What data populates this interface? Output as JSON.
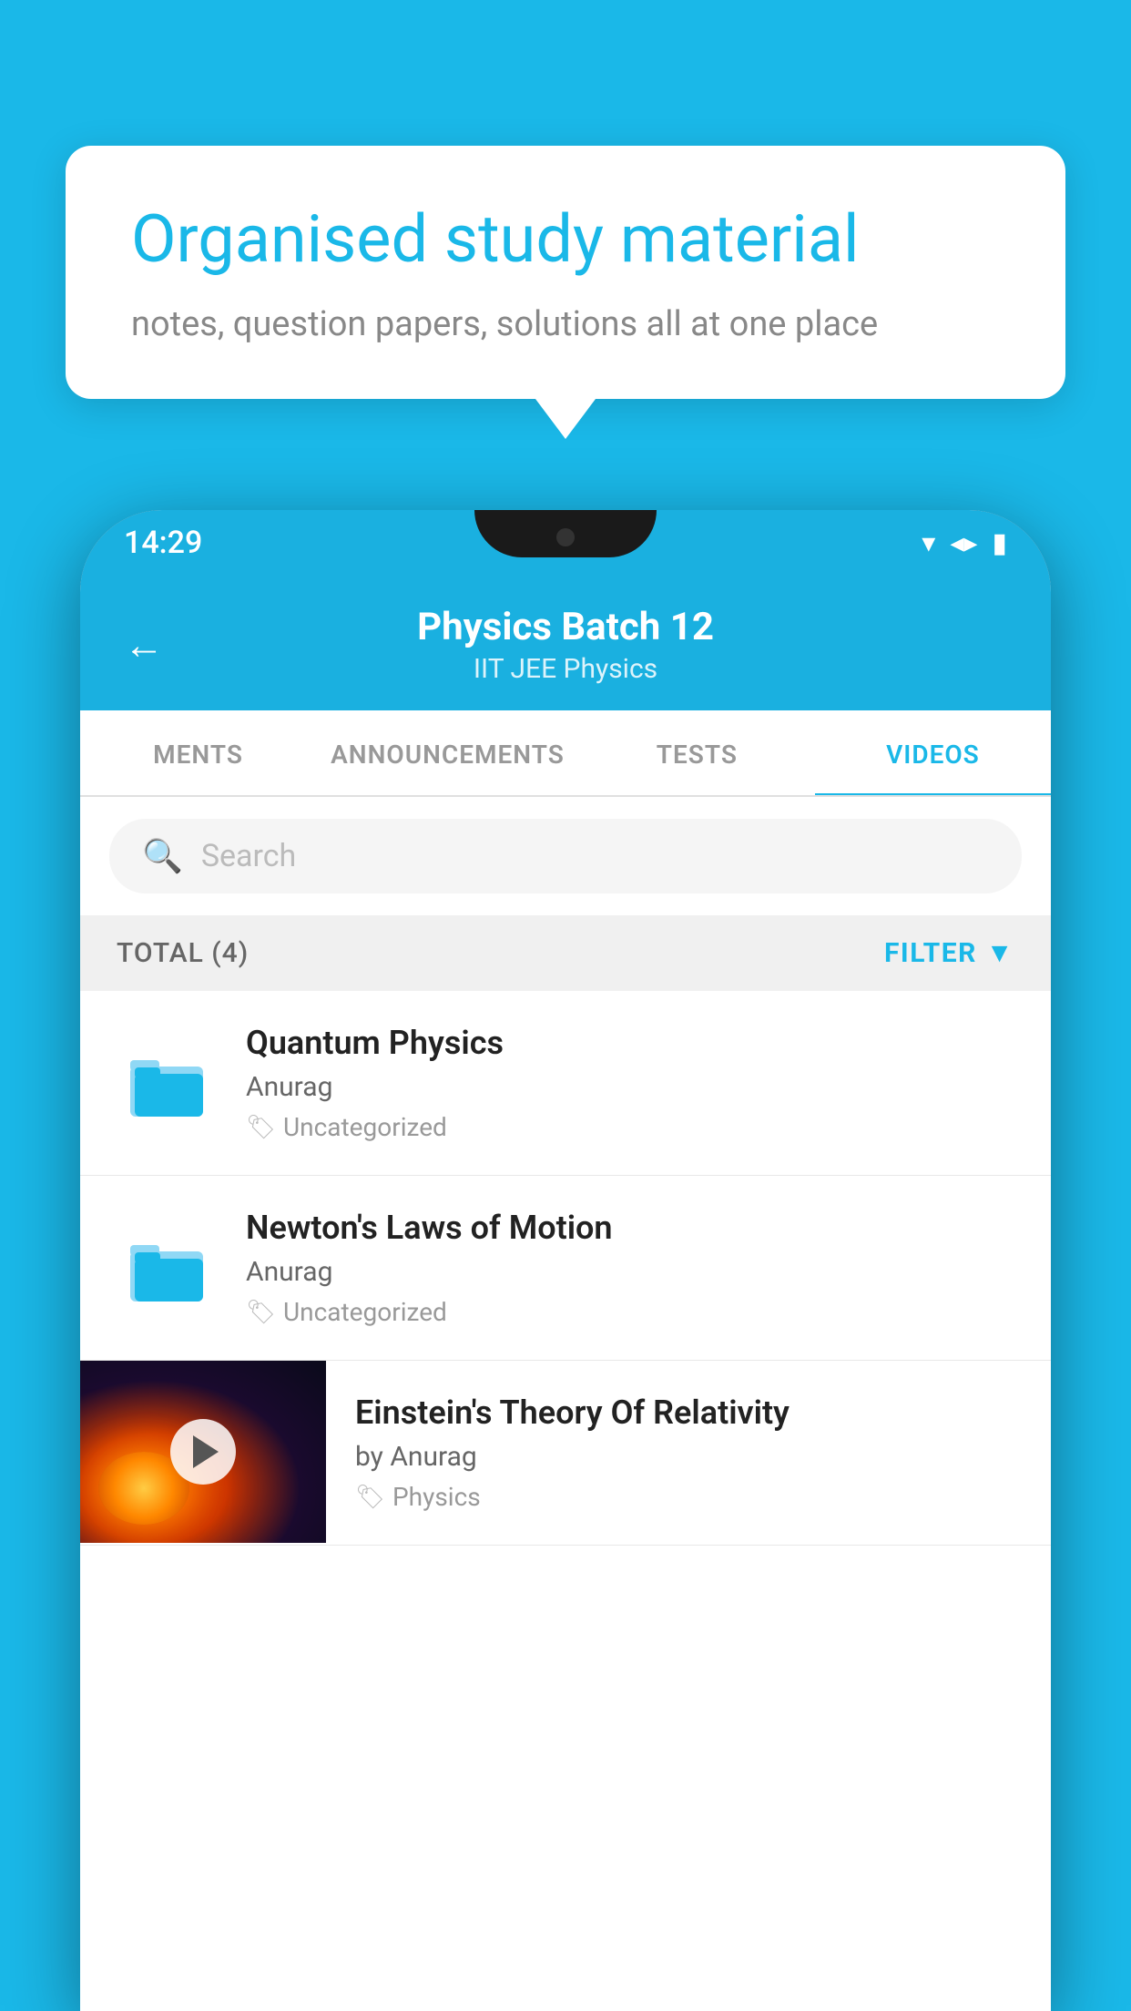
{
  "background_color": "#1ab8e8",
  "bubble": {
    "title": "Organised study material",
    "subtitle": "notes, question papers, solutions all at one place"
  },
  "phone": {
    "status_bar": {
      "time": "14:29",
      "icons": [
        "wifi",
        "signal",
        "battery"
      ]
    },
    "header": {
      "back_label": "←",
      "title": "Physics Batch 12",
      "subtitle": "IIT JEE   Physics"
    },
    "tabs": [
      {
        "label": "MENTS",
        "active": false
      },
      {
        "label": "ANNOUNCEMENTS",
        "active": false
      },
      {
        "label": "TESTS",
        "active": false
      },
      {
        "label": "VIDEOS",
        "active": true
      }
    ],
    "search": {
      "placeholder": "Search"
    },
    "filter_bar": {
      "total_label": "TOTAL (4)",
      "filter_label": "FILTER"
    },
    "videos": [
      {
        "id": 1,
        "title": "Quantum Physics",
        "author": "Anurag",
        "tag": "Uncategorized",
        "type": "folder",
        "has_thumbnail": false
      },
      {
        "id": 2,
        "title": "Newton's Laws of Motion",
        "author": "Anurag",
        "tag": "Uncategorized",
        "type": "folder",
        "has_thumbnail": false
      },
      {
        "id": 3,
        "title": "Einstein's Theory Of Relativity",
        "author": "by Anurag",
        "tag": "Physics",
        "type": "video",
        "has_thumbnail": true
      }
    ]
  }
}
